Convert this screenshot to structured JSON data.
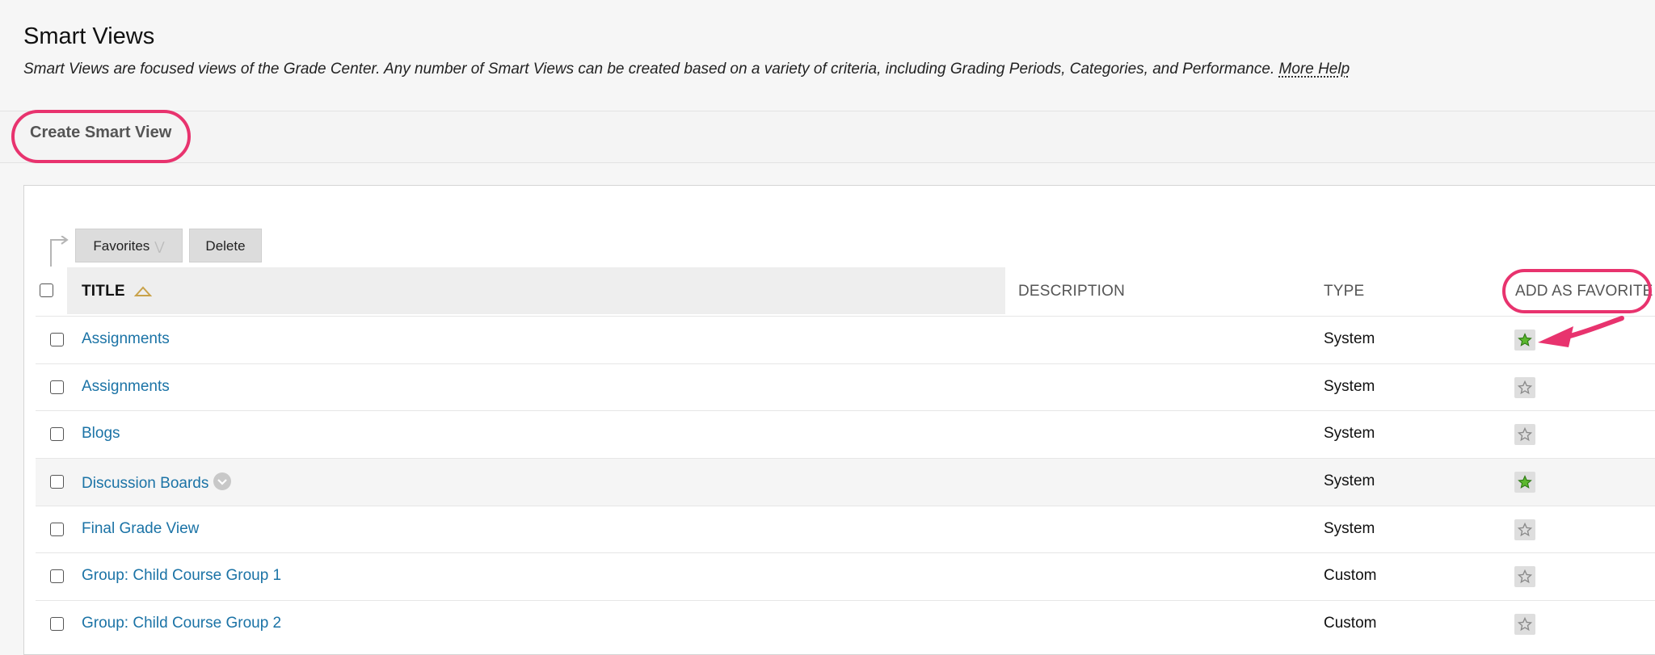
{
  "header": {
    "title": "Smart Views",
    "description": "Smart Views are focused views of the Grade Center. Any number of Smart Views can be created based on a variety of criteria, including Grading Periods, Categories, and Performance.",
    "more_help": "More Help"
  },
  "action_bar": {
    "create_label": "Create Smart View"
  },
  "list_actions": {
    "favorites_label": "Favorites",
    "delete_label": "Delete"
  },
  "columns": {
    "title": "TITLE",
    "description": "DESCRIPTION",
    "type": "TYPE",
    "favorite": "ADD AS FAVORITE"
  },
  "rows": [
    {
      "title": "Assignments",
      "type": "System",
      "favorite": true
    },
    {
      "title": "Assignments",
      "type": "System",
      "favorite": false
    },
    {
      "title": "Blogs",
      "type": "System",
      "favorite": false
    },
    {
      "title": "Discussion Boards",
      "type": "System",
      "favorite": true
    },
    {
      "title": "Final Grade View",
      "type": "System",
      "favorite": false
    },
    {
      "title": "Group: Child Course Group 1",
      "type": "Custom",
      "favorite": false
    },
    {
      "title": "Group: Child Course Group 2",
      "type": "Custom",
      "favorite": false
    }
  ],
  "colors": {
    "accent_highlight": "#e8336e",
    "link": "#1b73a6",
    "favorite_star": "#5cb82e",
    "unfavorite_star": "#9a9a9a"
  },
  "icons": {
    "sort": "sort-ascending-icon",
    "favorite": "star-icon",
    "menu": "chevron-down-icon"
  }
}
